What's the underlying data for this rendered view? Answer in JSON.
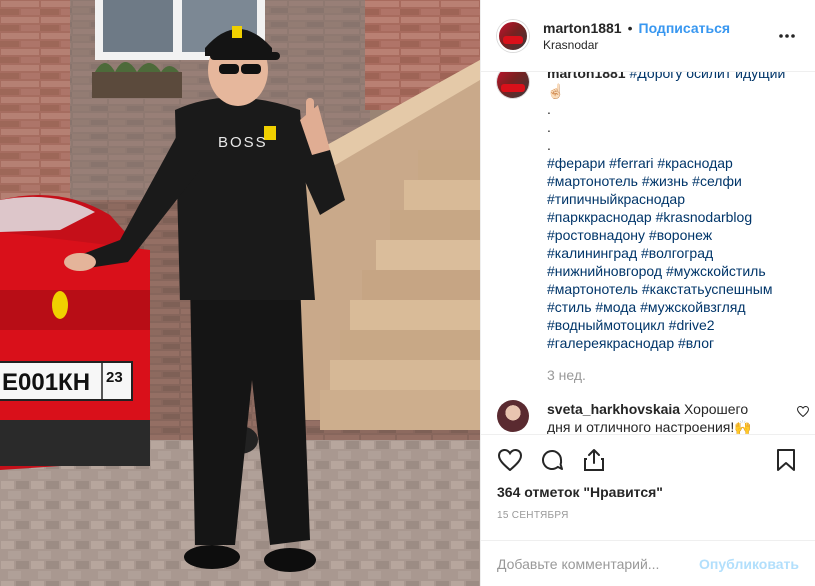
{
  "post": {
    "username": "marton1881",
    "follow_label": "Подписаться",
    "separator": "•",
    "location": "Krasnodar",
    "caption_user": "marton1881",
    "caption_first": "#Дорогу осилит идущий ☝🏻",
    "caption_dots": [
      ".",
      ".",
      "."
    ],
    "hashtag_lines": [
      "#ферари #ferrari #краснодар",
      "#мартонотель #жизнь #селфи",
      "#типичныйкраснодар",
      "#парккраснодар #krasnodarblog",
      "#ростовнадону #воронеж",
      "#калининград #волгоград",
      "#нижнийновгород #мужскойстиль",
      "#мартонотель #какстатьуспешным",
      "#стиль #мода #мужскойвзгляд",
      "#водныймотоцикл #drive2",
      "#галереякраснодар #влог"
    ],
    "caption_time": "3 нед.",
    "comment": {
      "user": "sveta_harkhovskaia",
      "text": "Хорошего дня и отличного настроения!🙌"
    },
    "likes": "364 отметок \"Нравится\"",
    "date": "15 СЕНТЯБРЯ",
    "comment_placeholder": "Добавьте комментарий...",
    "publish_label": "Опубликовать"
  },
  "photo": {
    "plate_text": "Е001КН",
    "plate_region": "23",
    "shirt_text": "BOSS"
  },
  "icons": {
    "more": "more-options-icon",
    "like": "heart-icon",
    "comment": "comment-icon",
    "share": "share-icon",
    "save": "bookmark-icon",
    "comment_like": "small-heart-icon"
  },
  "colors": {
    "link_blue": "#3897f0",
    "hashtag": "#003569",
    "muted": "#999999",
    "publish_disabled": "#b2dffc",
    "car_red": "#d9101a"
  }
}
